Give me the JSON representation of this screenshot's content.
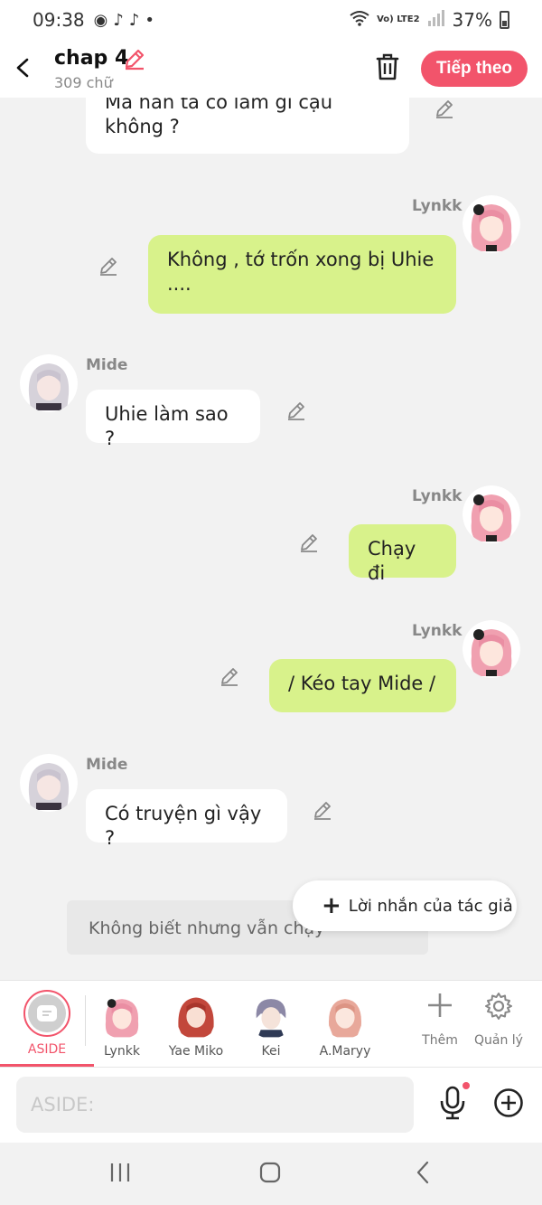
{
  "status": {
    "time": "09:38",
    "lte": "Vo) LTE2",
    "battery": "37%"
  },
  "header": {
    "title": "chap 4",
    "subtitle": "309 chữ",
    "next_label": "Tiếp theo"
  },
  "messages": [
    {
      "speaker": "",
      "text": "Mà hắn ta có làm gì cậu không ?"
    },
    {
      "speaker": "Lynkk",
      "text": "Không , tớ trốn xong bị Uhie ...."
    },
    {
      "speaker": "Mide",
      "text": "Uhie làm sao ?"
    },
    {
      "speaker": "Lynkk",
      "text": "Chạy đi"
    },
    {
      "speaker": "Lynkk",
      "text": "/ Kéo tay Mide /"
    },
    {
      "speaker": "Mide",
      "text": "Có truyện gì vậy ?"
    }
  ],
  "hint_text": "Không biết nhưng vẫn chạy",
  "author_note_label": "Lời nhắn của tác giả",
  "characters": {
    "aside": "ASIDE",
    "list": [
      "Lynkk",
      "Yae Miko",
      "Kei",
      "A.Maryy"
    ],
    "add_label": "Thêm",
    "manage_label": "Quản lý"
  },
  "input": {
    "placeholder": "ASIDE:"
  },
  "colors": {
    "accent": "#f2546b",
    "outgoing_bubble": "#d8f28b",
    "incoming_bubble": "#ffffff"
  },
  "icons": [
    "back-icon",
    "edit-icon",
    "trash-icon",
    "mic-icon",
    "add-circle-icon",
    "gear-icon",
    "plus-icon"
  ]
}
